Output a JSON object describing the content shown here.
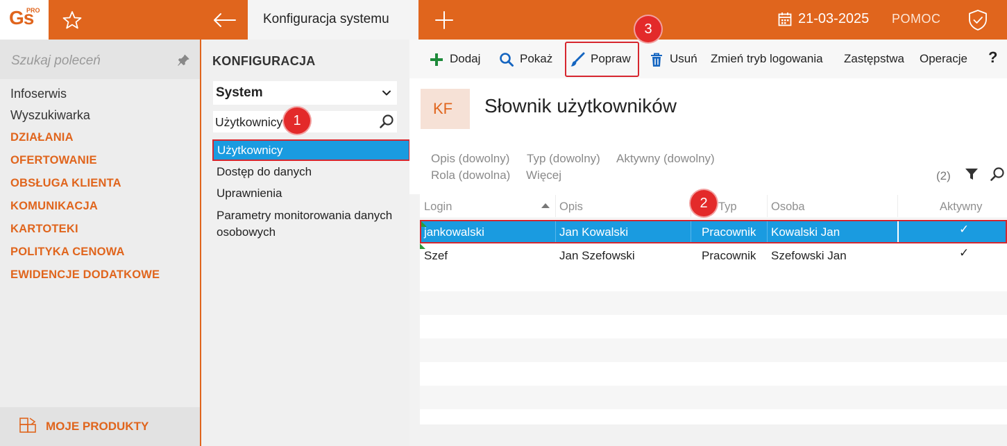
{
  "app": {
    "logo_text": "Gs",
    "logo_sup": "PRO",
    "tab_title": "Konfiguracja systemu",
    "date": "21-03-2025",
    "help": "POMOC"
  },
  "sidebar": {
    "search_placeholder": "Szukaj poleceń",
    "items": [
      "Infoserwis",
      "Wyszukiwarka"
    ],
    "sections": [
      "DZIAŁANIA",
      "OFERTOWANIE",
      "OBSŁUGA KLIENTA",
      "KOMUNIKACJA",
      "KARTOTEKI",
      "POLITYKA CENOWA",
      "EWIDENCJE DODATKOWE"
    ],
    "footer": "MOJE PRODUKTY"
  },
  "config": {
    "title": "KONFIGURACJA",
    "group_value": "System",
    "filter_value": "Użytkownicy",
    "tree": [
      "Użytkownicy",
      "Dostęp do danych",
      "Uprawnienia",
      "Parametry monitorowania danych",
      "osobowych"
    ]
  },
  "toolbar": {
    "add": "Dodaj",
    "show": "Pokaż",
    "edit": "Popraw",
    "delete": "Usuń",
    "login_mode": "Zmień tryb logowania",
    "substitutes": "Zastępstwa",
    "operations": "Operacje",
    "help": "?"
  },
  "header": {
    "badge": "KF",
    "title": "Słownik użytkowników"
  },
  "filters": {
    "desc": "Opis (dowolny)",
    "type": "Typ (dowolny)",
    "active": "Aktywny (dowolny)",
    "role": "Rola (dowolna)",
    "more": "Więcej",
    "count": "(2)"
  },
  "grid": {
    "columns": [
      "Login",
      "Opis",
      "Typ",
      "Osoba",
      "Aktywny"
    ],
    "rows": [
      {
        "login": "jankowalski",
        "desc": "Jan Kowalski",
        "type": "Pracownik",
        "person": "Kowalski Jan",
        "active": "✓"
      },
      {
        "login": "Szef",
        "desc": "Jan Szefowski",
        "type": "Pracownik",
        "person": "Szefowski Jan",
        "active": "✓"
      }
    ]
  },
  "annotations": [
    "1",
    "2",
    "3"
  ],
  "colors": {
    "brand_orange": "#e0651d",
    "selection_blue": "#1a9be0",
    "highlight_red": "#d6262e",
    "add_green": "#1e8a3a"
  }
}
